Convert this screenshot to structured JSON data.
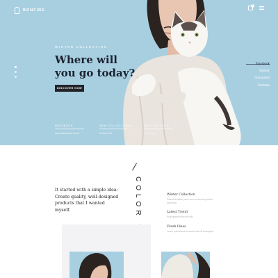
{
  "brand": {
    "name": "BONFIRE"
  },
  "header": {
    "cart_count": "0"
  },
  "hero": {
    "kicker": "WINTER COLLECTION",
    "title": "Where will you go today?",
    "cta_label": "DISCOVER NOW",
    "social": [
      "Facebook",
      "Twitter",
      "Instagram",
      "Youtube"
    ],
    "tabs": [
      {
        "label": "NOTABLE ▾",
        "sub": "New Wild Beanie Small"
      },
      {
        "label": "NEW COLLECTION ▾",
        "sub": "Pullover Set"
      },
      {
        "label": "BEST SELLER ▾",
        "sub": "Coat Dress"
      }
    ]
  },
  "intro": {
    "text": "It started with a simple idea: Create quality, well-designed products that I wanted myself."
  },
  "vertical_headline": "COLOR YOUR LI",
  "collections": [
    {
      "title": "Winter Collection",
      "desc": "Praesent sapien purus nunc commodo pretium fusce sed."
    },
    {
      "title": "Latest Trend",
      "desc": "Proin gravida nibh vel velit."
    },
    {
      "title": "Fresh Ideas",
      "desc": "Lorem quis bibendum auctor nisi elit consequat."
    }
  ],
  "colors": {
    "hero_bg": "#a8cfe0",
    "dark": "#23242a",
    "panel": "#f3f3f5"
  }
}
